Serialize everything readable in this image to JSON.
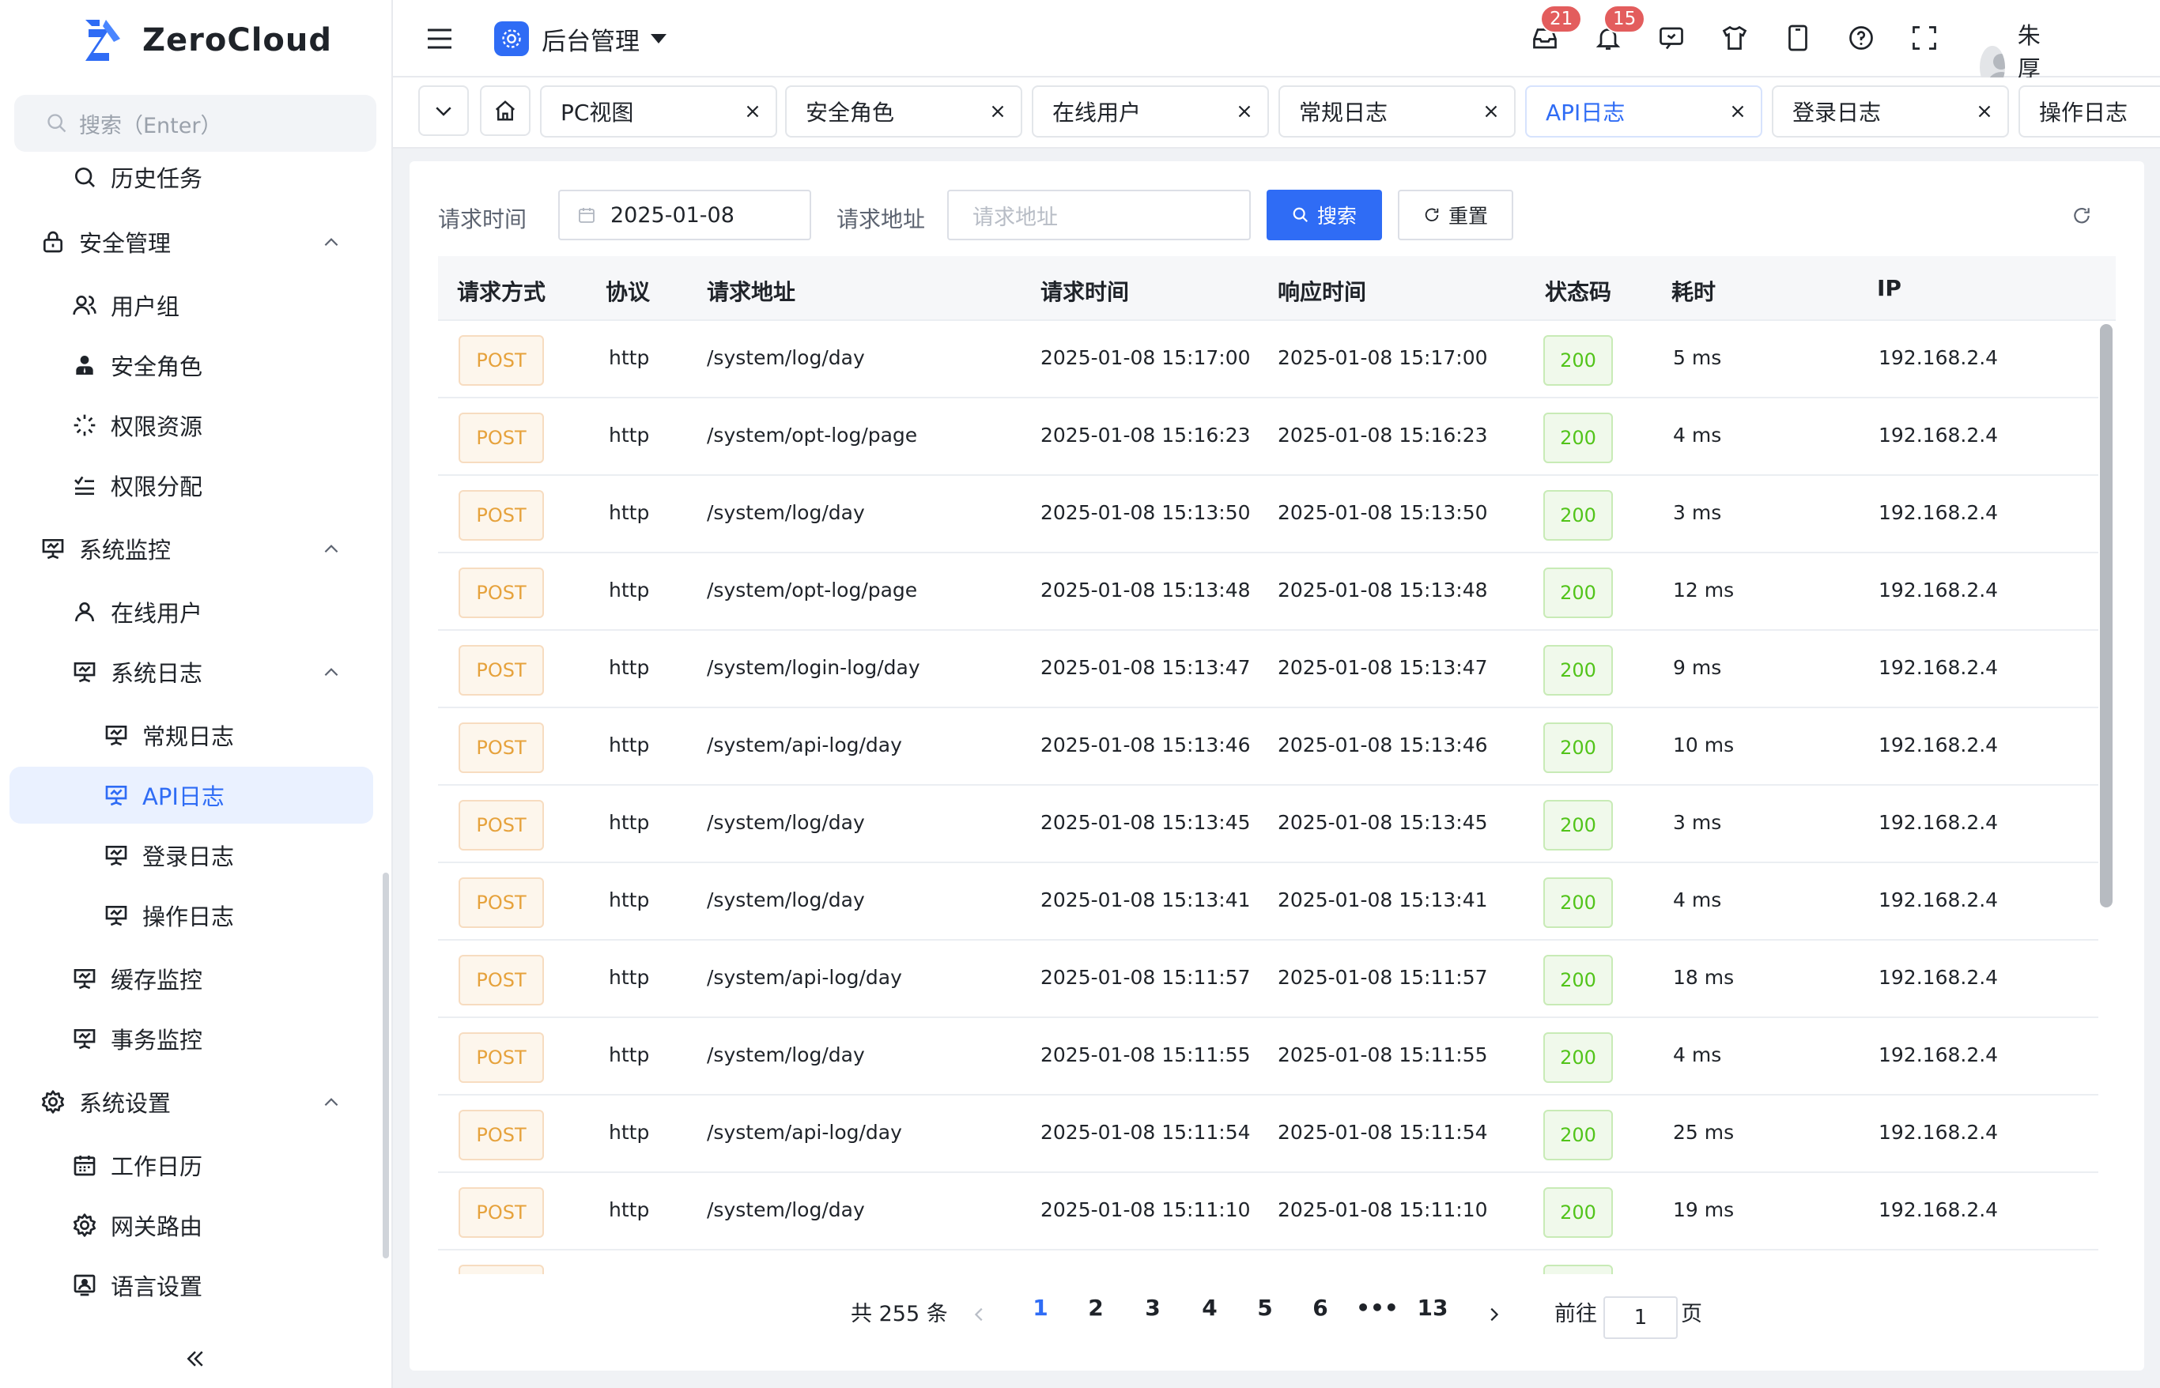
{
  "app": {
    "name": "ZeroCloud",
    "brand_color": "#2f6cf5"
  },
  "sidebar": {
    "search_placeholder": "搜索（Enter）",
    "menu": [
      {
        "label": "历史任务",
        "icon": "search-icon"
      },
      {
        "label": "安全管理",
        "icon": "lock-icon"
      },
      {
        "label": "用户组",
        "icon": "users-icon"
      },
      {
        "label": "安全角色",
        "icon": "role-icon"
      },
      {
        "label": "权限资源",
        "icon": "spinner-icon"
      },
      {
        "label": "权限分配",
        "icon": "list-check-icon"
      },
      {
        "label": "系统监控",
        "icon": "monitor-icon"
      },
      {
        "label": "在线用户",
        "icon": "user-icon"
      },
      {
        "label": "系统日志",
        "icon": "monitor-icon"
      },
      {
        "label": "常规日志",
        "icon": "monitor-icon"
      },
      {
        "label": "API日志",
        "icon": "monitor-icon"
      },
      {
        "label": "登录日志",
        "icon": "monitor-icon"
      },
      {
        "label": "操作日志",
        "icon": "monitor-icon"
      },
      {
        "label": "缓存监控",
        "icon": "monitor-icon"
      },
      {
        "label": "事务监控",
        "icon": "monitor-icon"
      },
      {
        "label": "系统设置",
        "icon": "gear-icon"
      },
      {
        "label": "工作日历",
        "icon": "calendar-icon"
      },
      {
        "label": "网关路由",
        "icon": "gear-icon"
      },
      {
        "label": "语言设置",
        "icon": "language-icon"
      }
    ]
  },
  "header": {
    "app_switch_label": "后台管理",
    "inbox_badge": "21",
    "bell_badge": "15",
    "user_name": "朱厚熜"
  },
  "tabs": [
    {
      "label": "PC视图"
    },
    {
      "label": "安全角色"
    },
    {
      "label": "在线用户"
    },
    {
      "label": "常规日志"
    },
    {
      "label": "API日志",
      "active": true
    },
    {
      "label": "登录日志"
    },
    {
      "label": "操作日志"
    }
  ],
  "filters": {
    "time_label": "请求时间",
    "time_value": "2025-01-08",
    "url_label": "请求地址",
    "url_placeholder": "请求地址",
    "search_button": "搜索",
    "reset_button": "重置"
  },
  "table": {
    "columns": [
      "请求方式",
      "协议",
      "请求地址",
      "请求时间",
      "响应时间",
      "状态码",
      "耗时",
      "IP"
    ],
    "rows": [
      [
        "POST",
        "http",
        "/system/log/day",
        "2025-01-08 15:17:00",
        "2025-01-08 15:17:00",
        "200",
        "5 ms",
        "192.168.2.4"
      ],
      [
        "POST",
        "http",
        "/system/opt-log/page",
        "2025-01-08 15:16:23",
        "2025-01-08 15:16:23",
        "200",
        "4 ms",
        "192.168.2.4"
      ],
      [
        "POST",
        "http",
        "/system/log/day",
        "2025-01-08 15:13:50",
        "2025-01-08 15:13:50",
        "200",
        "3 ms",
        "192.168.2.4"
      ],
      [
        "POST",
        "http",
        "/system/opt-log/page",
        "2025-01-08 15:13:48",
        "2025-01-08 15:13:48",
        "200",
        "12 ms",
        "192.168.2.4"
      ],
      [
        "POST",
        "http",
        "/system/login-log/day",
        "2025-01-08 15:13:47",
        "2025-01-08 15:13:47",
        "200",
        "9 ms",
        "192.168.2.4"
      ],
      [
        "POST",
        "http",
        "/system/api-log/day",
        "2025-01-08 15:13:46",
        "2025-01-08 15:13:46",
        "200",
        "10 ms",
        "192.168.2.4"
      ],
      [
        "POST",
        "http",
        "/system/log/day",
        "2025-01-08 15:13:45",
        "2025-01-08 15:13:45",
        "200",
        "3 ms",
        "192.168.2.4"
      ],
      [
        "POST",
        "http",
        "/system/log/day",
        "2025-01-08 15:13:41",
        "2025-01-08 15:13:41",
        "200",
        "4 ms",
        "192.168.2.4"
      ],
      [
        "POST",
        "http",
        "/system/api-log/day",
        "2025-01-08 15:11:57",
        "2025-01-08 15:11:57",
        "200",
        "18 ms",
        "192.168.2.4"
      ],
      [
        "POST",
        "http",
        "/system/log/day",
        "2025-01-08 15:11:55",
        "2025-01-08 15:11:55",
        "200",
        "4 ms",
        "192.168.2.4"
      ],
      [
        "POST",
        "http",
        "/system/api-log/day",
        "2025-01-08 15:11:54",
        "2025-01-08 15:11:54",
        "200",
        "25 ms",
        "192.168.2.4"
      ],
      [
        "POST",
        "http",
        "/system/log/day",
        "2025-01-08 15:11:10",
        "2025-01-08 15:11:10",
        "200",
        "19 ms",
        "192.168.2.4"
      ]
    ]
  },
  "pagination": {
    "total_text": "共 255 条",
    "pages": [
      "1",
      "2",
      "3",
      "4",
      "5",
      "6",
      "•••",
      "13"
    ],
    "current": "1",
    "goto_label": "前往",
    "goto_value": "1",
    "page_suffix": "页"
  }
}
